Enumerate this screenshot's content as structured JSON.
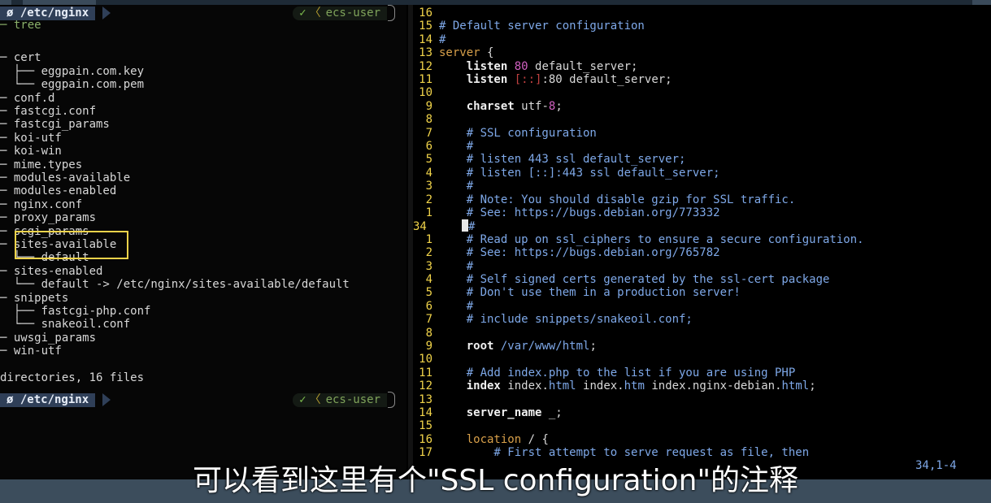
{
  "prompt": {
    "path": "ø /etc/nginx",
    "check": "✓",
    "lt": "〈",
    "user": "ecs-user"
  },
  "tree_command": "─ tree",
  "tree_lines": [
    "",
    "─ cert",
    "  ├── eggpain.com.key",
    "  └── eggpain.com.pem",
    "─ conf.d",
    "─ fastcgi.conf",
    "─ fastcgi_params",
    "─ koi-utf",
    "─ koi-win",
    "─ mime.types",
    "─ modules-available",
    "─ modules-enabled",
    "─ nginx.conf",
    "─ proxy_params",
    "─ scgi_params",
    "─ sites-available",
    "  └── default",
    "─ sites-enabled",
    "  └── default -> /etc/nginx/sites-available/default",
    "─ snippets",
    "  ├── fastcgi-php.conf",
    "  └── snakeoil.conf",
    "─ uwsgi_params",
    "─ win-utf",
    "",
    "directories, 16 files"
  ],
  "editor": {
    "lines": [
      {
        "n": "16",
        "t": ""
      },
      {
        "n": "15",
        "t": "# Default server configuration"
      },
      {
        "n": "14",
        "t": "#"
      },
      {
        "n": "13",
        "t": "server {"
      },
      {
        "n": "12",
        "t": "    listen 80 default_server;"
      },
      {
        "n": "11",
        "t": "    listen [::]:80 default_server;"
      },
      {
        "n": "10",
        "t": ""
      },
      {
        "n": "9",
        "t": "    charset utf-8;"
      },
      {
        "n": "8",
        "t": ""
      },
      {
        "n": "7",
        "t": "    # SSL configuration"
      },
      {
        "n": "6",
        "t": "    #"
      },
      {
        "n": "5",
        "t": "    # listen 443 ssl default_server;"
      },
      {
        "n": "4",
        "t": "    # listen [::]:443 ssl default_server;"
      },
      {
        "n": "3",
        "t": "    #"
      },
      {
        "n": "2",
        "t": "    # Note: You should disable gzip for SSL traffic."
      },
      {
        "n": "1",
        "t": "    # See: https://bugs.debian.org/773332"
      },
      {
        "n": "34",
        "t": "#"
      },
      {
        "n": "1",
        "t": "    # Read up on ssl_ciphers to ensure a secure configuration."
      },
      {
        "n": "2",
        "t": "    # See: https://bugs.debian.org/765782"
      },
      {
        "n": "3",
        "t": "    #"
      },
      {
        "n": "4",
        "t": "    # Self signed certs generated by the ssl-cert package"
      },
      {
        "n": "5",
        "t": "    # Don't use them in a production server!"
      },
      {
        "n": "6",
        "t": "    #"
      },
      {
        "n": "7",
        "t": "    # include snippets/snakeoil.conf;"
      },
      {
        "n": "8",
        "t": ""
      },
      {
        "n": "9",
        "t": "    root /var/www/html;"
      },
      {
        "n": "10",
        "t": ""
      },
      {
        "n": "11",
        "t": "    # Add index.php to the list if you are using PHP"
      },
      {
        "n": "12",
        "t": "    index index.html index.htm index.nginx-debian.html;"
      },
      {
        "n": "13",
        "t": ""
      },
      {
        "n": "14",
        "t": "    server_name _;"
      },
      {
        "n": "15",
        "t": ""
      },
      {
        "n": "16",
        "t": "    location / {"
      },
      {
        "n": "17",
        "t": "        # First attempt to serve request as file, then"
      }
    ],
    "cursor_position": "34,1-4"
  },
  "subtitle": "可以看到这里有个\"SSL configuration\"的注释",
  "colors": {
    "highlight_box": "#f0d34a",
    "line_numbers": "#f0d34a",
    "comments": "#7ea8e8",
    "prompt_bg": "#2f3f58"
  }
}
